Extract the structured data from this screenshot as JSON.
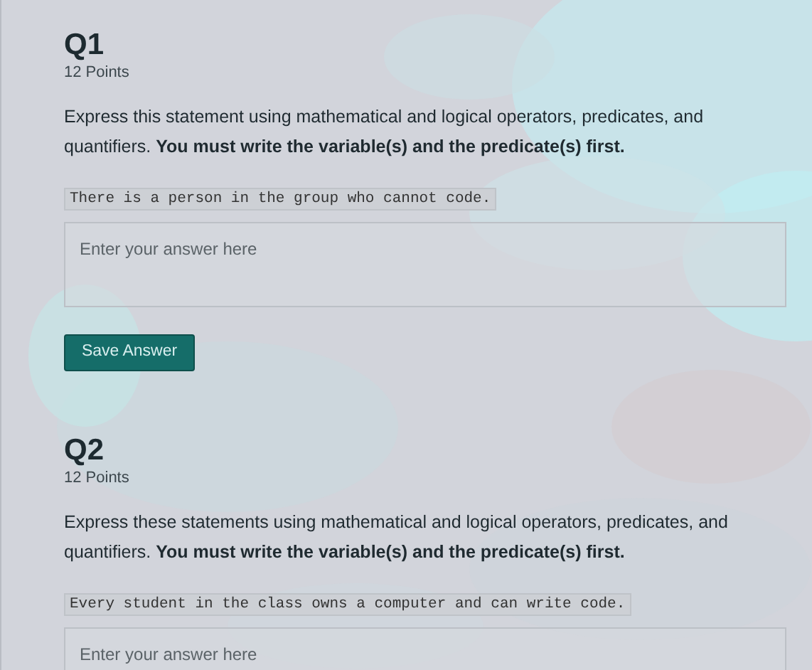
{
  "questions": [
    {
      "title": "Q1",
      "points": "12 Points",
      "prompt": "Express this statement using mathematical and logical operators, predicates, and quantifiers. **You must write the variable(s) and the predicate(s) first.**",
      "statement": "There is a person in the group who cannot code.",
      "answer": {
        "placeholder": "Enter your answer here"
      },
      "save_button": "Save Answer"
    },
    {
      "title": "Q2",
      "points": "12 Points",
      "prompt": "Express these statements using mathematical and logical operators, predicates, and quantifiers. **You must write the variable(s) and the predicate(s) first.**",
      "statement": "Every student in the class owns a computer and can write code.",
      "answer": {
        "placeholder": "Enter your answer here"
      }
    }
  ]
}
